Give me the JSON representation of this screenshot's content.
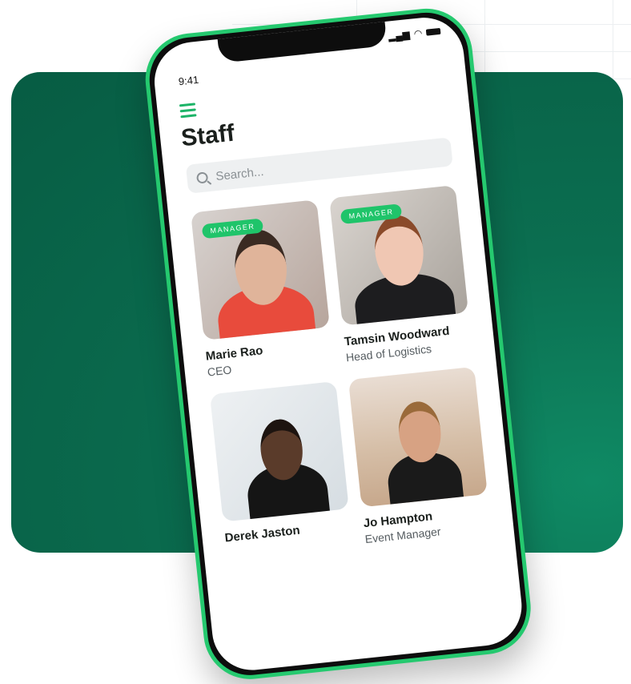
{
  "status": {
    "time": "9:41"
  },
  "page": {
    "title": "Staff"
  },
  "search": {
    "placeholder": "Search..."
  },
  "staff": [
    {
      "name": "Marie Rao",
      "role": "CEO",
      "badge": "MANAGER"
    },
    {
      "name": "Tamsin Woodward",
      "role": "Head of Logistics",
      "badge": "MANAGER"
    },
    {
      "name": "Derek Jaston",
      "role": ""
    },
    {
      "name": "Jo Hampton",
      "role": "Event Manager"
    }
  ],
  "colors": {
    "accent": "#1fc46a",
    "frame": "#25c96f",
    "card_bg": "#0b6e50"
  }
}
